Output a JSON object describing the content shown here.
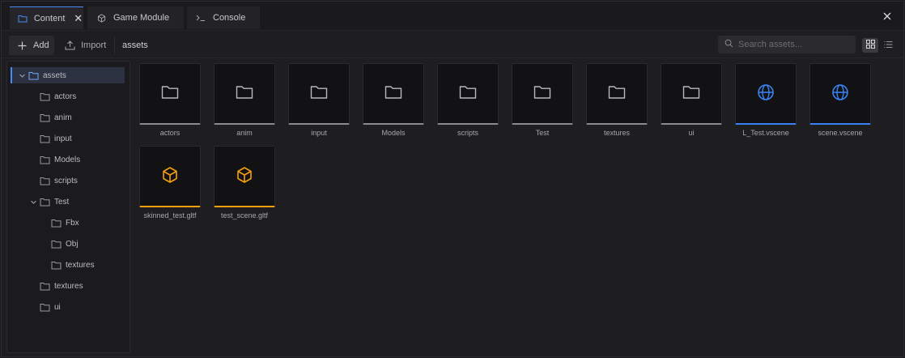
{
  "tabs": [
    {
      "label": "Content",
      "icon": "folder-icon",
      "active": true,
      "closable": true
    },
    {
      "label": "Game Module",
      "icon": "cube-icon",
      "active": false,
      "closable": false
    },
    {
      "label": "Console",
      "icon": "terminal-icon",
      "active": false,
      "closable": false
    }
  ],
  "toolbar": {
    "add_label": "Add",
    "import_label": "Import",
    "breadcrumb": "assets",
    "search_placeholder": "Search assets...",
    "view_mode": "grid"
  },
  "tree": [
    {
      "label": "assets",
      "depth": 0,
      "expanded": true,
      "selected": true,
      "has_children": true
    },
    {
      "label": "actors",
      "depth": 1
    },
    {
      "label": "anim",
      "depth": 1
    },
    {
      "label": "input",
      "depth": 1
    },
    {
      "label": "Models",
      "depth": 1
    },
    {
      "label": "scripts",
      "depth": 1
    },
    {
      "label": "Test",
      "depth": 1,
      "expanded": true,
      "has_children": true
    },
    {
      "label": "Fbx",
      "depth": 2
    },
    {
      "label": "Obj",
      "depth": 2
    },
    {
      "label": "textures",
      "depth": 2
    },
    {
      "label": "textures",
      "depth": 1
    },
    {
      "label": "ui",
      "depth": 1
    }
  ],
  "assets": [
    {
      "name": "actors",
      "kind": "folder"
    },
    {
      "name": "anim",
      "kind": "folder"
    },
    {
      "name": "input",
      "kind": "folder"
    },
    {
      "name": "Models",
      "kind": "folder"
    },
    {
      "name": "scripts",
      "kind": "folder"
    },
    {
      "name": "Test",
      "kind": "folder"
    },
    {
      "name": "textures",
      "kind": "folder"
    },
    {
      "name": "ui",
      "kind": "folder"
    },
    {
      "name": "L_Test.vscene",
      "kind": "scene"
    },
    {
      "name": "scene.vscene",
      "kind": "scene"
    },
    {
      "name": "skinned_test.gltf",
      "kind": "gltf"
    },
    {
      "name": "test_scene.gltf",
      "kind": "gltf"
    }
  ],
  "colors": {
    "accent": "#4a8bf5",
    "scene": "#3b82f6",
    "gltf": "#f59e0b",
    "folder": "#8a8a8f"
  }
}
